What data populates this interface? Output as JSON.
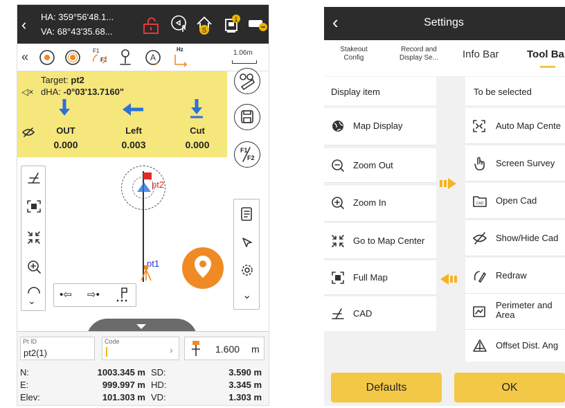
{
  "left": {
    "header": {
      "ha": "HA: 359°56'48.1...",
      "va": "VA: 68°43'35.68...",
      "badge_s": "S",
      "badge_1": "1"
    },
    "toolbar": {
      "f1": "F1",
      "f2": "F2",
      "hz": "Hz",
      "scale": "1.06m"
    },
    "stake": {
      "target_label": "Target:",
      "target": "pt2",
      "dha_label": "dHA:",
      "dha": "-0°03'13.7160\"",
      "cols": [
        {
          "dir": "OUT",
          "val": "0.000"
        },
        {
          "dir": "Left",
          "val": "0.003"
        },
        {
          "dir": "Cut",
          "val": "0.000"
        }
      ]
    },
    "map": {
      "pt2": "pt2",
      "pt1": "pt1",
      "f1f2_top": "F1",
      "f1f2_bottom": "F2"
    },
    "inputs": {
      "ptid_label": "Pt ID",
      "ptid": "pt2(1)",
      "code_label": "Code",
      "code": "",
      "height": "1.600",
      "unit": "m"
    },
    "readouts": [
      {
        "l1": "N:",
        "v1": "1003.345 m",
        "l2": "SD:",
        "v2": "3.590 m"
      },
      {
        "l1": "E:",
        "v1": "999.997 m",
        "l2": "HD:",
        "v2": "3.345 m"
      },
      {
        "l1": "Elev:",
        "v1": "101.303 m",
        "l2": "VD:",
        "v2": "1.303 m"
      }
    ]
  },
  "right": {
    "title": "Settings",
    "tabs": [
      {
        "label": "Stakeout Config"
      },
      {
        "label": "Record and Display Se..."
      },
      {
        "label": "Info Bar"
      },
      {
        "label": "Tool Bar"
      }
    ],
    "display_header": "Display item",
    "select_header": "To be selected",
    "display_items": [
      {
        "icon": "globe-icon",
        "label": "Map Display"
      },
      {
        "icon": "zoom-out-icon",
        "label": "Zoom Out"
      },
      {
        "icon": "zoom-in-icon",
        "label": "Zoom In"
      },
      {
        "icon": "center-icon",
        "label": "Go to Map Center"
      },
      {
        "icon": "full-map-icon",
        "label": "Full Map"
      },
      {
        "icon": "cad-icon",
        "label": "CAD"
      }
    ],
    "select_items": [
      {
        "icon": "auto-center-icon",
        "label": "Auto Map Cente"
      },
      {
        "icon": "hand-icon",
        "label": "Screen Survey"
      },
      {
        "icon": "folder-icon",
        "label": "Open Cad"
      },
      {
        "icon": "eye-slash-icon",
        "label": "Show/Hide Cad"
      },
      {
        "icon": "redraw-icon",
        "label": "Redraw"
      },
      {
        "icon": "area-icon",
        "label": "Perimeter and Area"
      },
      {
        "icon": "offset-icon",
        "label": "Offset Dist. Ang"
      }
    ],
    "buttons": {
      "defaults": "Defaults",
      "ok": "OK"
    },
    "colors": {
      "accent": "#f3c846",
      "arrow": "#f5b323",
      "header": "#2c2c2c"
    }
  }
}
